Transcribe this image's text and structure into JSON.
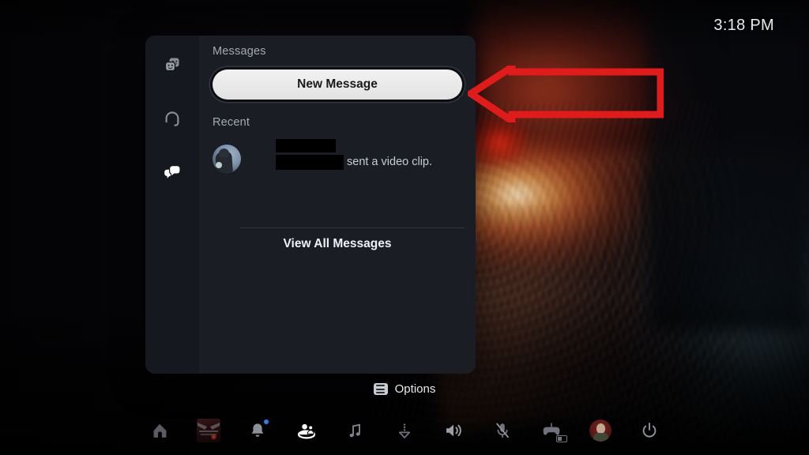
{
  "system": {
    "clock": "3:18 PM",
    "platform_theme_dark": "#1a1d24",
    "accent_white": "#f2f2f2",
    "annotation_color": "#e01b1b"
  },
  "card": {
    "rail": {
      "items": [
        {
          "name": "friends-icon",
          "label": "Friends",
          "active": false
        },
        {
          "name": "headset-icon",
          "label": "Voice Chat",
          "active": false
        },
        {
          "name": "messages-icon",
          "label": "Messages",
          "active": true
        }
      ]
    },
    "title": "Messages",
    "new_message_label": "New Message",
    "recent_label": "Recent",
    "recent": {
      "sender_redacted": true,
      "message_text": "sent a video clip."
    },
    "view_all_label": "View All Messages"
  },
  "options": {
    "label": "Options",
    "icon": "options-menu-icon"
  },
  "annotation": {
    "type": "arrow",
    "direction": "left",
    "points_to": "new-message-button",
    "color": "#e01b1b"
  },
  "dock": {
    "items": [
      {
        "name": "home-icon",
        "label": "Home"
      },
      {
        "name": "game-thumbnail",
        "label": "Game"
      },
      {
        "name": "notifications-icon",
        "label": "Notifications",
        "badge": true
      },
      {
        "name": "game-base-icon",
        "label": "Game Base",
        "active": true
      },
      {
        "name": "music-icon",
        "label": "Music"
      },
      {
        "name": "downloads-icon",
        "label": "Downloads"
      },
      {
        "name": "sound-icon",
        "label": "Sound"
      },
      {
        "name": "microphone-muted-icon",
        "label": "Microphone"
      },
      {
        "name": "accessories-icon",
        "label": "Accessories"
      },
      {
        "name": "profile-avatar",
        "label": "Profile"
      },
      {
        "name": "power-icon",
        "label": "Power"
      }
    ]
  }
}
